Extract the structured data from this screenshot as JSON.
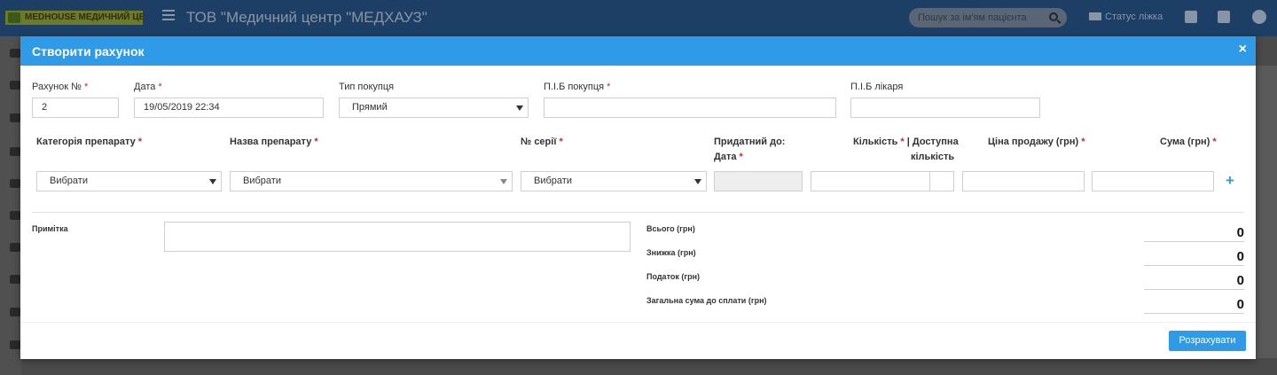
{
  "app": {
    "logo_text": "MEDHOUSE МЕДИЧНИЙ ЦЕНТР",
    "title": "ТОВ \"Медичний центр \"МЕДХАУЗ\"",
    "search_placeholder": "Пошук за ім'ям пацієнта",
    "status_bed_label": "Статус ліжка"
  },
  "modal": {
    "title": "Створити рахунок",
    "close_glyph": "×",
    "invoice_no": {
      "label": "Рахунок №",
      "value": "2"
    },
    "date": {
      "label": "Дата",
      "value": "19/05/2019 22:34"
    },
    "buyer_type": {
      "label": "Тип покупця",
      "value": "Прямий"
    },
    "buyer_name": {
      "label": "П.І.Б покупця",
      "value": ""
    },
    "doctor_name": {
      "label": "П.І.Б лікаря",
      "value": ""
    },
    "required_mark": "*",
    "items_header": {
      "category": "Категорія препарату",
      "drug_name": "Назва препарату",
      "series": "№ серії",
      "valid_until_line1": "Придатний до:",
      "valid_until_line2": "Дата",
      "quantity": "Кількість",
      "separator": "|",
      "available_line1": "Доступна",
      "available_line2": "кількість",
      "price": "Ціна продажу (грн)",
      "sum": "Сума (грн)"
    },
    "items_row": {
      "category_value": "Вибрати",
      "drug_name_value": "Вибрати",
      "series_value": "Вибрати",
      "add_glyph": "+"
    },
    "note_label": "Примітка",
    "totals": {
      "total_label": "Всього (грн)",
      "total_value": "0",
      "discount_label": "Знижка (грн)",
      "discount_value": "0",
      "tax_label": "Податок (грн)",
      "tax_value": "0",
      "grand_label": "Загальна сума до сплати (грн)",
      "grand_value": "0"
    },
    "calculate_button": "Розрахувати"
  },
  "colors": {
    "header_blue": "#2f9be8",
    "required_red": "#d9232d",
    "navbar": "#1d3f66"
  },
  "icons": [
    "hamburger-icon",
    "search-icon",
    "bed-icon",
    "calendar-icon",
    "checkbox-icon",
    "user-avatar-icon",
    "close-icon",
    "plus-icon",
    "chevron-down-icon"
  ]
}
